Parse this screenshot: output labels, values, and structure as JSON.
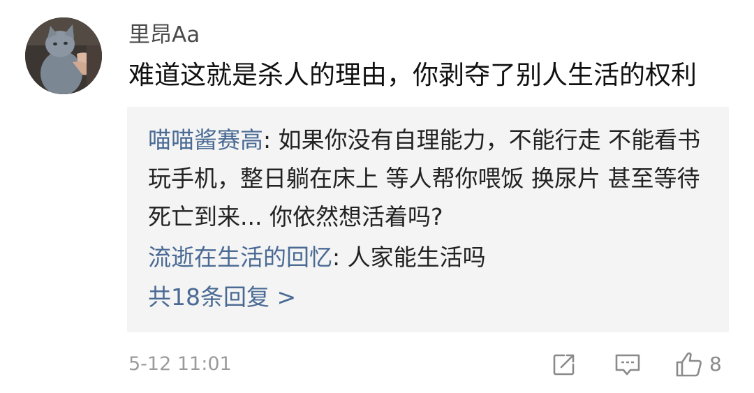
{
  "comment": {
    "username": "里昂Aa",
    "text": "难道这就是杀人的理由，你剥夺了别人生活的权利",
    "timestamp": "5-12 11:01",
    "like_count": "8"
  },
  "replies": {
    "items": [
      {
        "author": "喵喵酱赛高",
        "separator": ": ",
        "text": "如果你没有自理能力，不能行走 不能看书 玩手机，整日躺在床上 等人帮你喂饭 换尿片 甚至等待死亡到来... 你依然想活着吗?"
      },
      {
        "author": "流逝在生活的回忆",
        "separator": ": ",
        "text": "人家能生活吗"
      }
    ],
    "more_label": "共18条回复 >"
  },
  "icons": {
    "avatar": "cat-avatar",
    "share": "share-icon",
    "reply": "comment-icon",
    "like": "thumbs-up-icon"
  },
  "colors": {
    "link": "#4a6a94",
    "reply_background": "#f4f4f4",
    "meta": "#9b9b9b"
  }
}
